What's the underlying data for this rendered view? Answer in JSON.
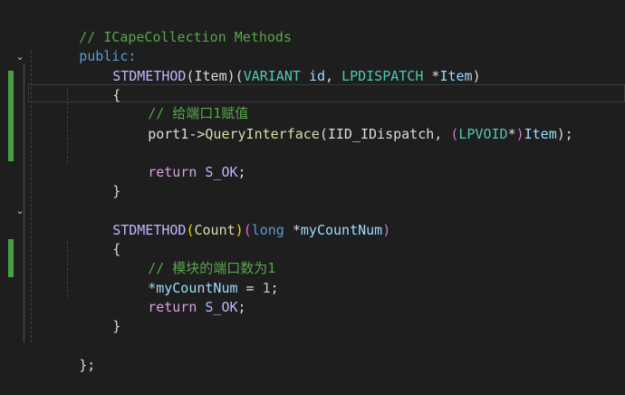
{
  "editor": {
    "comment_header": "// ICapeCollection Methods",
    "access_specifier": "public:",
    "item_method": {
      "macro": "STDMETHOD",
      "name": "Item",
      "param1_type": "VARIANT",
      "param1_name": "id",
      "param2_type": "LPDISPATCH",
      "param2_ptr": "*",
      "param2_name": "Item",
      "comment": "// 给端口1赋值",
      "stmt_object": "port1",
      "stmt_arrow": "->",
      "stmt_call": "QueryInterface",
      "stmt_arg1": "IID_IDispatch",
      "stmt_cast_type": "LPVOID",
      "stmt_cast_ptr": "*",
      "stmt_arg2": "Item",
      "return_keyword": "return",
      "return_value": "S_OK"
    },
    "count_method": {
      "macro": "STDMETHOD",
      "name": "Count",
      "param_type": "long",
      "param_ptr": "*",
      "param_name": "myCountNum",
      "comment": "// 模块的端口数为1",
      "assign_target": "*myCountNum",
      "assign_value": "1",
      "return_keyword": "return",
      "return_value": "S_OK"
    },
    "class_end": "};",
    "icons": {
      "fold_expanded": "chevron-down-icon"
    },
    "colors": {
      "background": "#1e1e1e",
      "comment": "#57a64a",
      "keyword": "#569cd6",
      "control_keyword": "#d8a0df",
      "macro": "#beb7ff",
      "function": "#dcdcaa",
      "type": "#4ec9b0",
      "parameter": "#9cdcfe",
      "number": "#b5cea8",
      "change_marker": "#4a9f45"
    }
  }
}
